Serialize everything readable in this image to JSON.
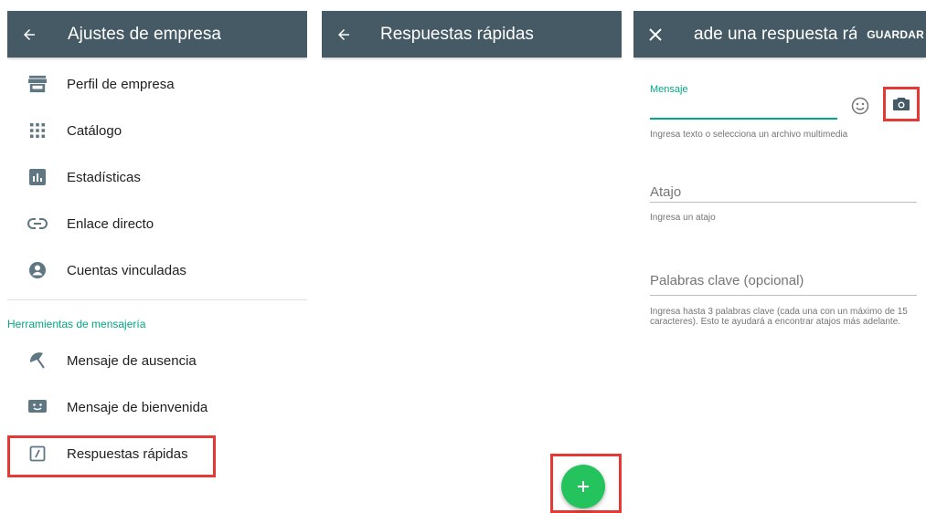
{
  "panel_business_settings": {
    "title": "Ajustes de empresa",
    "items": [
      {
        "label": "Perfil de empresa",
        "icon": "storefront-icon"
      },
      {
        "label": "Catálogo",
        "icon": "grid-icon"
      },
      {
        "label": "Estadísticas",
        "icon": "bar-chart-icon"
      },
      {
        "label": "Enlace directo",
        "icon": "link-icon"
      },
      {
        "label": "Cuentas vinculadas",
        "icon": "account-circle-icon"
      }
    ],
    "section_header": "Herramientas de mensajería",
    "messaging_items": [
      {
        "label": "Mensaje de ausencia",
        "icon": "beach-umbrella-icon"
      },
      {
        "label": "Mensaje de bienvenida",
        "icon": "welcome-message-icon"
      },
      {
        "label": "Respuestas rápidas",
        "icon": "quick-reply-icon"
      }
    ]
  },
  "panel_quick_replies": {
    "title": "Respuestas rápidas",
    "fab_icon": "plus-icon"
  },
  "panel_add_quick_reply": {
    "title": "ade una respuesta ráp",
    "save_label": "GUARDAR",
    "message": {
      "label": "Mensaje",
      "value": "",
      "hint": "Ingresa texto o selecciona un archivo multimedia"
    },
    "shortcut": {
      "placeholder": "Atajo",
      "hint": "Ingresa un atajo"
    },
    "keywords": {
      "placeholder": "Palabras clave (opcional)",
      "hint": "Ingresa hasta 3 palabras clave (cada una con un máximo de 15 caracteres). Esto te ayudará a encontrar atajos más adelante."
    }
  },
  "colors": {
    "app_bar": "#455a64",
    "accent": "#00a884",
    "fab": "#25c35e",
    "highlight": "#e53935",
    "icon": "#5f7782"
  }
}
